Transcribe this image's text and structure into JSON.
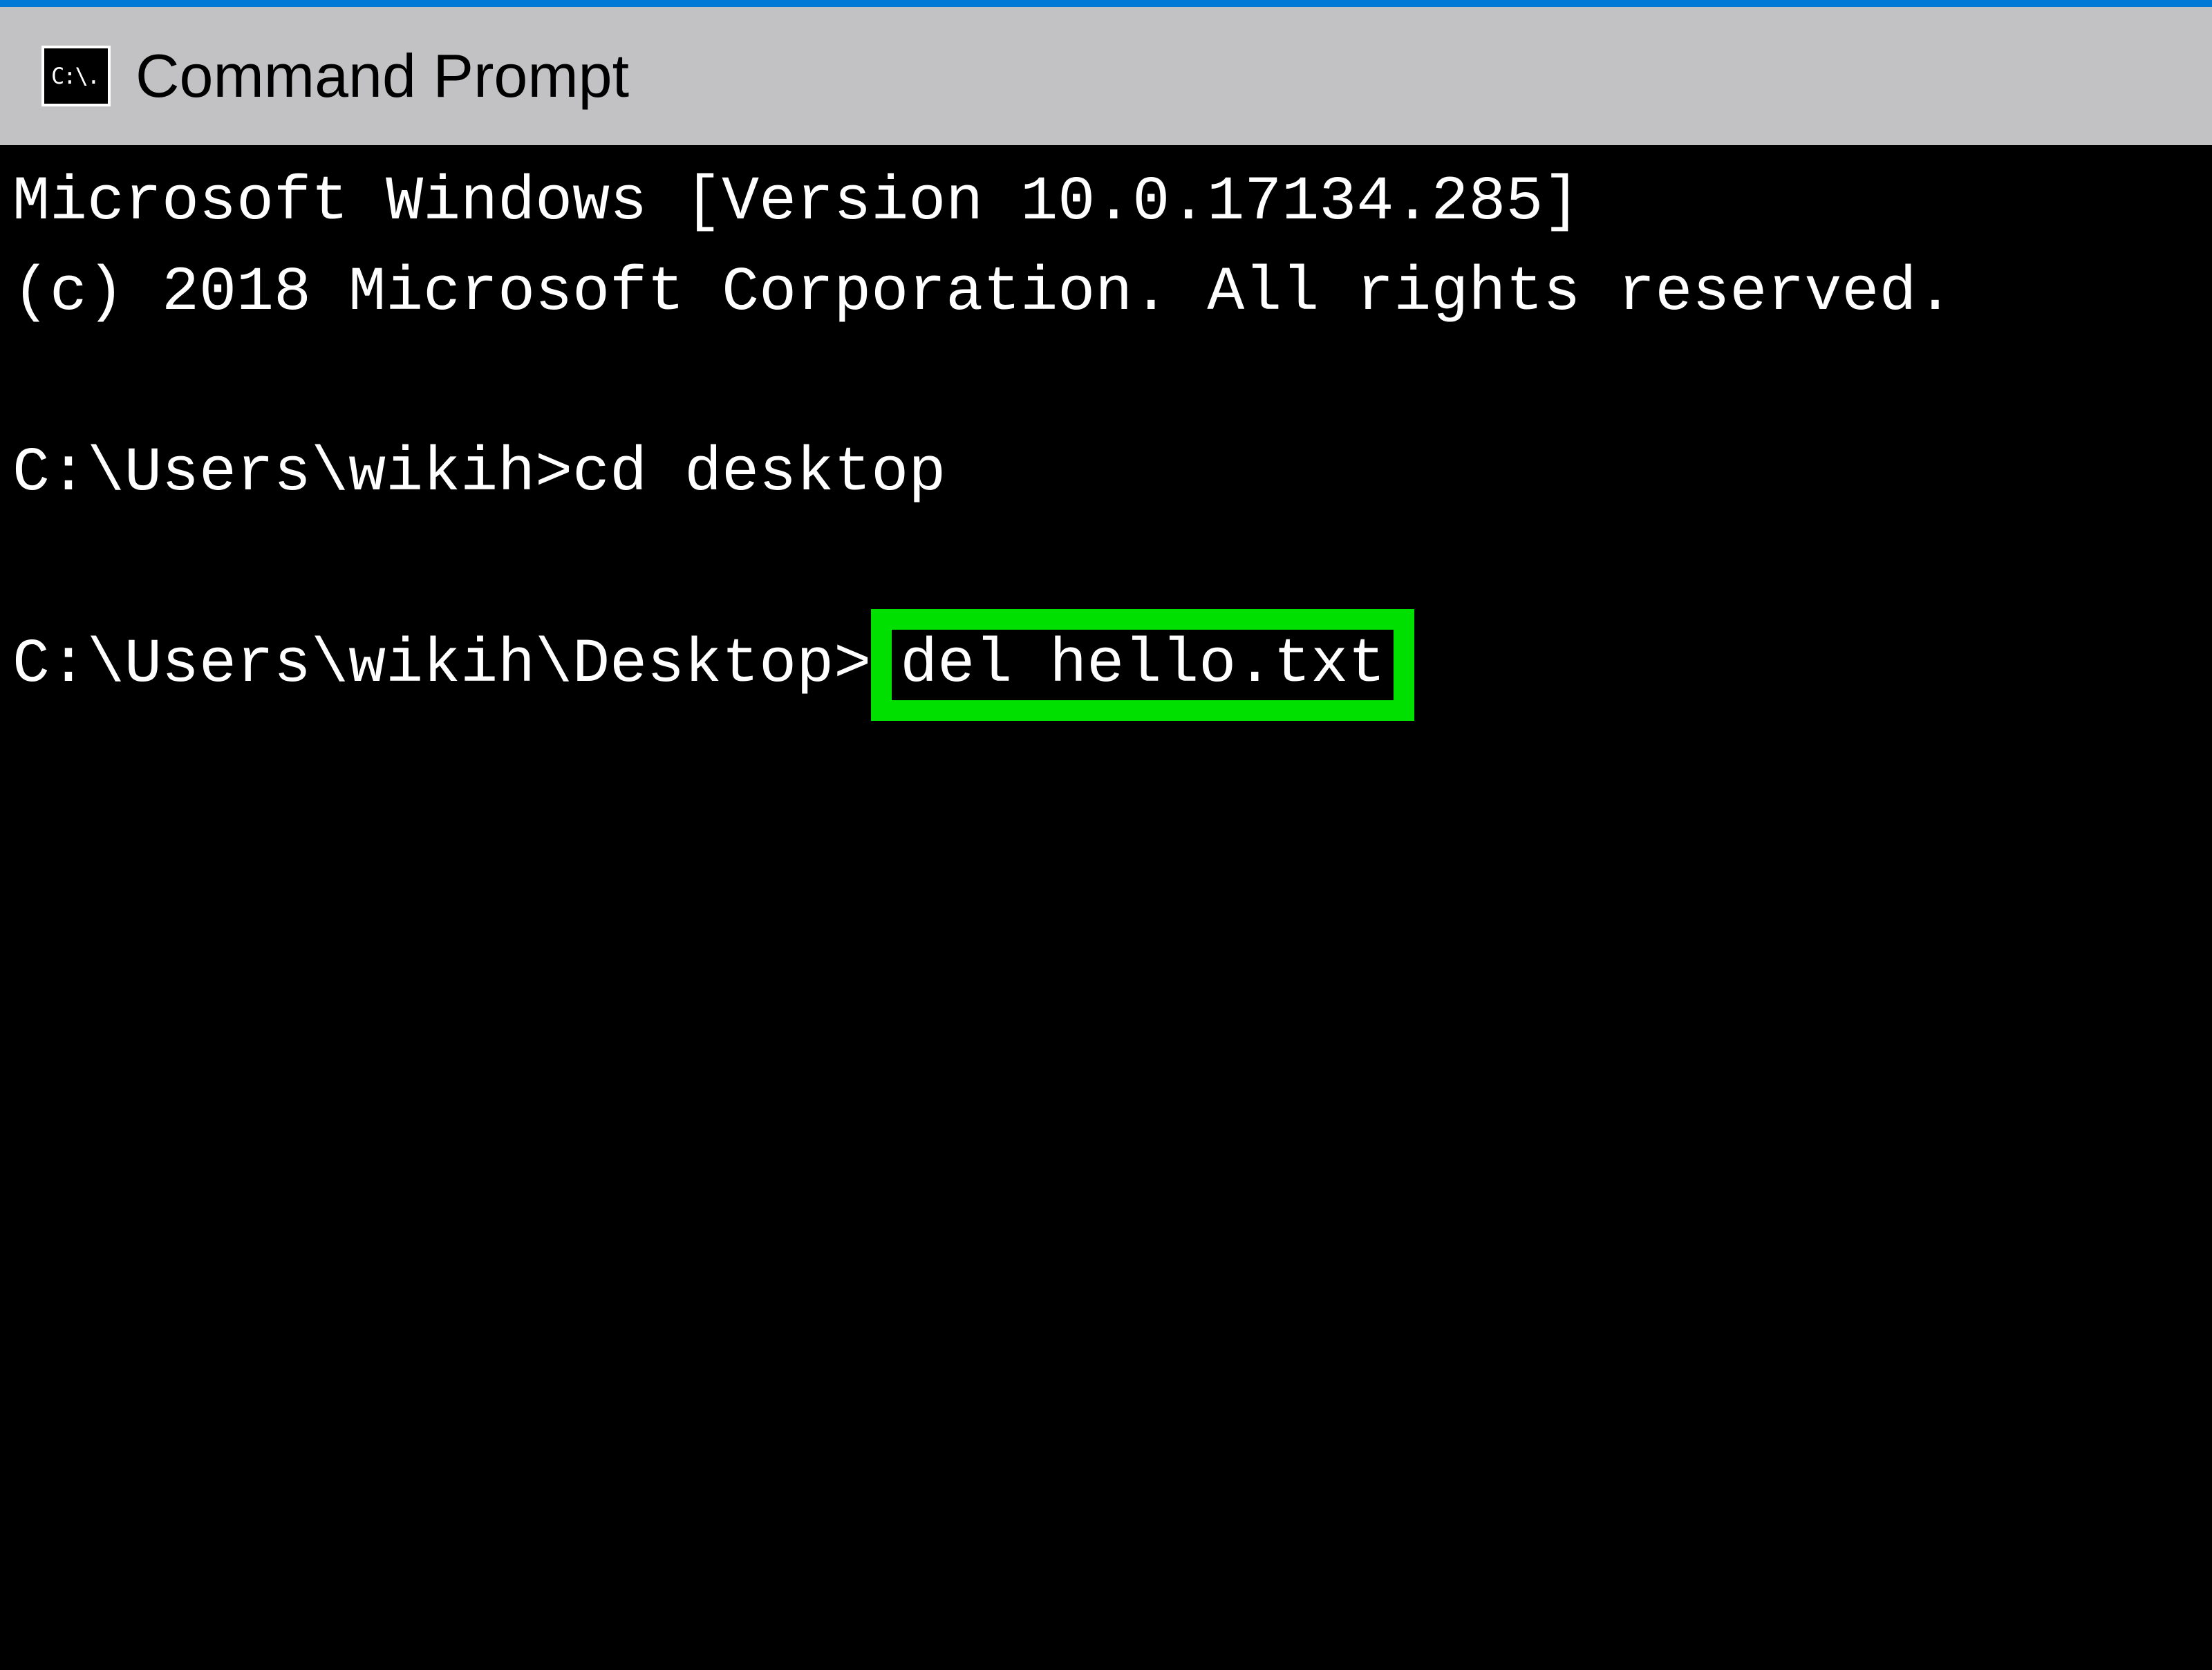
{
  "window": {
    "title": "Command Prompt",
    "icon_glyph": "C:\\."
  },
  "terminal": {
    "version_line": "Microsoft Windows [Version 10.0.17134.285]",
    "copyright_line": "(c) 2018 Microsoft Corporation. All rights reserved.",
    "prompt1_prefix": "C:\\Users\\wikih>",
    "prompt1_command": "cd desktop",
    "prompt2_prefix": "C:\\Users\\wikih\\Desktop>",
    "prompt2_command": "del hello.txt"
  },
  "colors": {
    "titlebar_bg": "#c2c2c4",
    "window_top_border": "#0078d6",
    "terminal_bg": "#000000",
    "terminal_fg": "#ffffff",
    "highlight": "#00e000"
  }
}
